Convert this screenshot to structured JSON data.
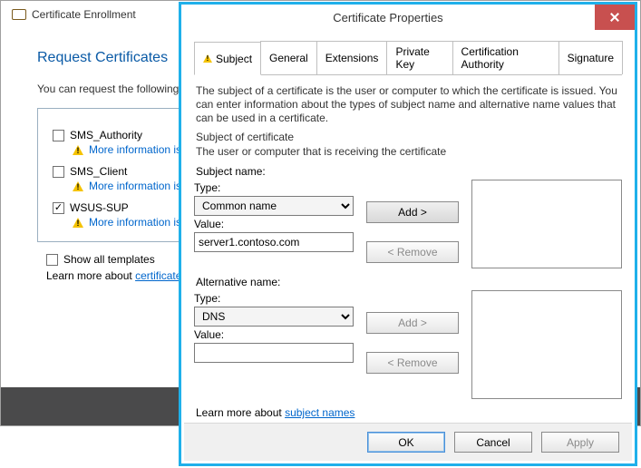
{
  "enroll": {
    "window_title": "Certificate Enrollment",
    "heading": "Request Certificates",
    "intro": "You can request the following types of certificates. Select the certificates you want to request, and then click Enroll.",
    "templates": [
      {
        "name": "SMS_Authority",
        "checked": false,
        "more": "More information is required to enroll for this certificate."
      },
      {
        "name": "SMS_Client",
        "checked": false,
        "more": "More information is required to enroll for this certificate."
      },
      {
        "name": "WSUS-SUP",
        "checked": true,
        "more": "More information is required to enroll for this certificate."
      }
    ],
    "show_all_label": "Show all templates",
    "learn_prefix": "Learn more about ",
    "learn_link": "certificates"
  },
  "dialog": {
    "title": "Certificate Properties",
    "tabs": {
      "subject": "Subject",
      "general": "General",
      "extensions": "Extensions",
      "private_key": "Private Key",
      "ca": "Certification Authority",
      "signature": "Signature"
    },
    "description": "The subject of a certificate is the user or computer to which the certificate is issued. You can enter information about the types of subject name and alternative name values that can be used in a certificate.",
    "soc_head": "Subject of certificate",
    "soc_sub": "The user or computer that is receiving the certificate",
    "subject_name": {
      "group": "Subject name:",
      "type_label": "Type:",
      "type_value": "Common name",
      "value_label": "Value:",
      "value": "server1.contoso.com",
      "add": "Add >",
      "remove": "< Remove"
    },
    "alt_name": {
      "group": "Alternative name:",
      "type_label": "Type:",
      "type_value": "DNS",
      "value_label": "Value:",
      "value": "",
      "add": "Add >",
      "remove": "< Remove"
    },
    "learn_prefix": "Learn more about ",
    "learn_link": "subject names",
    "footer": {
      "ok": "OK",
      "cancel": "Cancel",
      "apply": "Apply"
    }
  }
}
